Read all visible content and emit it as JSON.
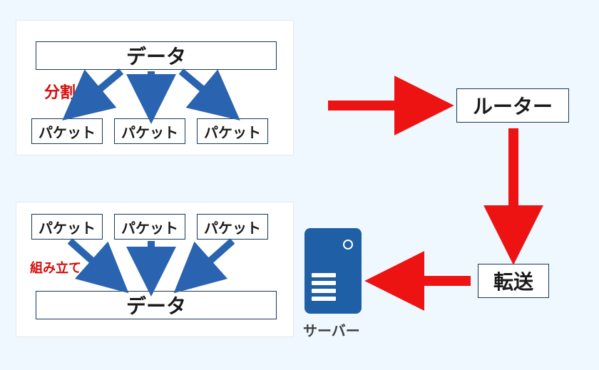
{
  "top": {
    "data_label": "データ",
    "split_label": "分割",
    "packets": [
      "パケット",
      "パケット",
      "パケット"
    ]
  },
  "bottom": {
    "packets": [
      "パケット",
      "パケット",
      "パケット"
    ],
    "assemble_label": "組み立て",
    "data_label": "データ"
  },
  "router": {
    "label": "ルーター"
  },
  "transfer": {
    "label": "転送"
  },
  "server": {
    "label": "サーバー"
  },
  "colors": {
    "blue_arrow": "#2a63b0",
    "red_arrow": "#ee1313",
    "box_border": "#17375e",
    "red_text": "#d70b0b",
    "server_fill": "#1e5fa6"
  }
}
